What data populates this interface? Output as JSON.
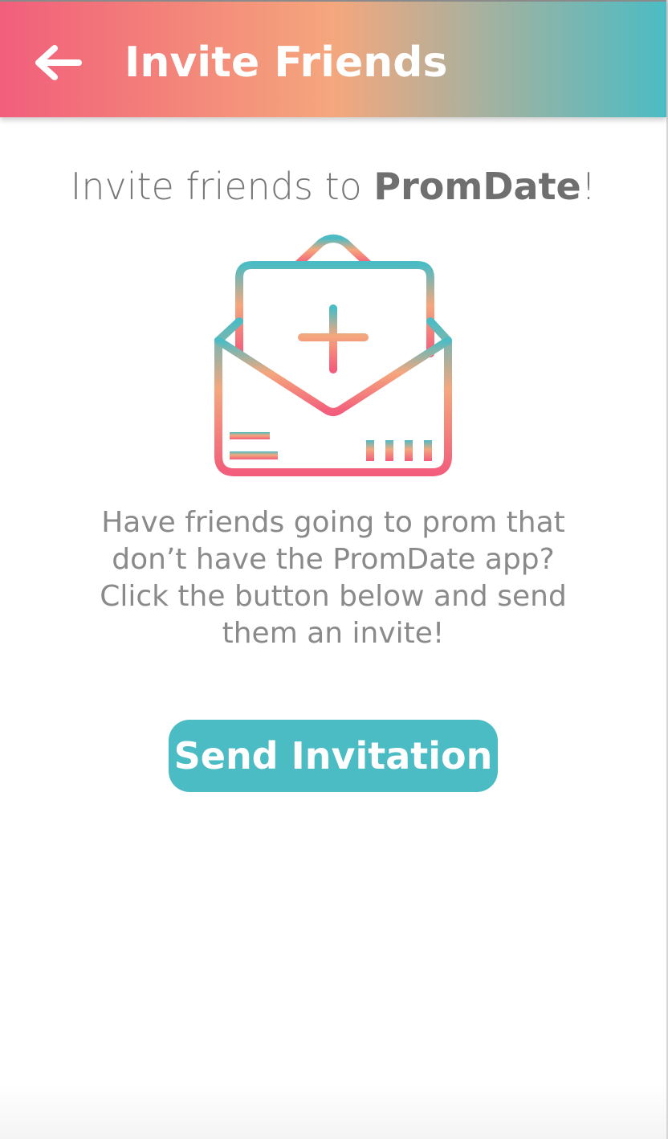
{
  "header": {
    "title": "Invite Friends",
    "back_icon": "arrow-left-icon"
  },
  "main": {
    "headline_prefix": "Invite friends to ",
    "headline_brand": "PromDate",
    "headline_suffix": "!",
    "illustration_icon": "envelope-invite-icon",
    "description_lines": [
      "Have friends going to prom that",
      "don’t have the PromDate app?",
      "Click the button below and send",
      "them an invite!"
    ],
    "send_button_label": "Send Invitation"
  },
  "colors": {
    "gradient_pink": "#f25e7b",
    "gradient_peach": "#f5a77d",
    "gradient_teal": "#4bbcc4",
    "button_teal": "#4bbcc4",
    "text_gray": "#8a8a8a"
  }
}
